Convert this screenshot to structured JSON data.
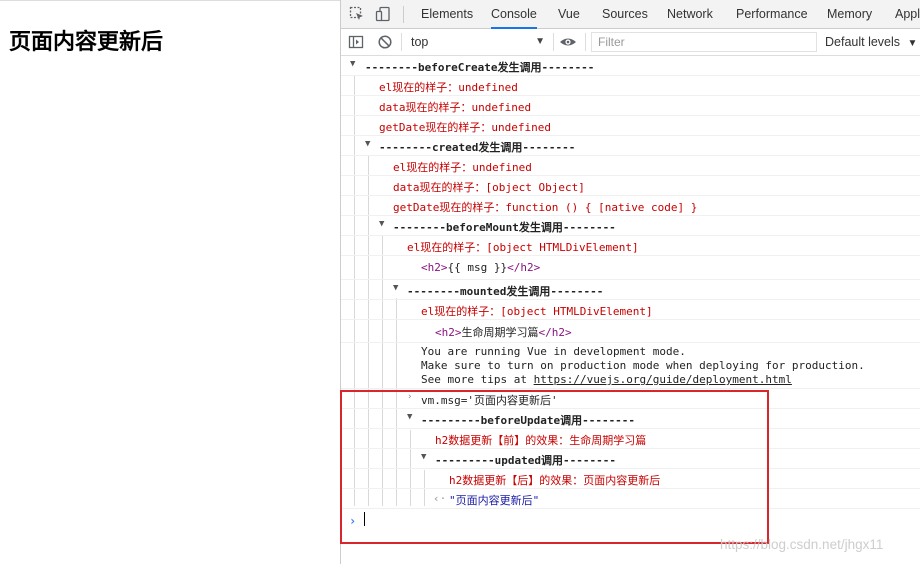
{
  "page": {
    "heading": "页面内容更新后"
  },
  "devtools": {
    "tabs": [
      "Elements",
      "Console",
      "Vue",
      "Sources",
      "Network",
      "Performance",
      "Memory",
      "Appl"
    ],
    "active_tab": "Console",
    "toolbar": {
      "context": "top",
      "filter_placeholder": "Filter",
      "levels": "Default levels"
    }
  },
  "console": {
    "beforeCreate": {
      "header": "--------beforeCreate发生调用--------",
      "el_label": "el现在的样子：",
      "el_value": "undefined",
      "data_label": "data现在的样子：",
      "data_value": "undefined",
      "getDate_label": "getDate现在的样子：",
      "getDate_value": "undefined"
    },
    "created": {
      "header": "--------created发生调用--------",
      "el_label": "el现在的样子：",
      "el_value": "undefined",
      "data_label": "data现在的样子：",
      "data_value": "[object Object]",
      "getDate_label": "getDate现在的样子：",
      "getDate_value": "function () { [native code] }"
    },
    "beforeMount": {
      "header": "--------beforeMount发生调用--------",
      "el_label": "el现在的样子：",
      "el_value": "[object HTMLDivElement]",
      "tag_open": "<h2>",
      "tag_text": "{{ msg }}",
      "tag_close": "</h2>"
    },
    "mounted": {
      "header": "--------mounted发生调用--------",
      "el_label": "el现在的样子：",
      "el_value": "[object HTMLDivElement]",
      "tag_open": "<h2>",
      "tag_text": "生命周期学习篇",
      "tag_close": "</h2>",
      "vue_msg_1": "You are running Vue in development mode.",
      "vue_msg_2": "Make sure to turn on production mode when deploying for production.",
      "vue_msg_3_prefix": "See more tips at ",
      "vue_msg_3_link": "https://vuejs.org/guide/deployment.html"
    },
    "command": "vm.msg='页面内容更新后'",
    "beforeUpdate": {
      "header": "---------beforeUpdate调用--------",
      "line": "h2数据更新【前】的效果：生命周期学习篇"
    },
    "updated": {
      "header": "---------updated调用--------",
      "line": "h2数据更新【后】的效果：页面内容更新后"
    },
    "result": "\"页面内容更新后\""
  },
  "watermark": "https://blog.csdn.net/jhgx11",
  "colors": {
    "highlight": "#d9262c",
    "error_red": "#c80000",
    "active_tab": "#1a73e8"
  }
}
